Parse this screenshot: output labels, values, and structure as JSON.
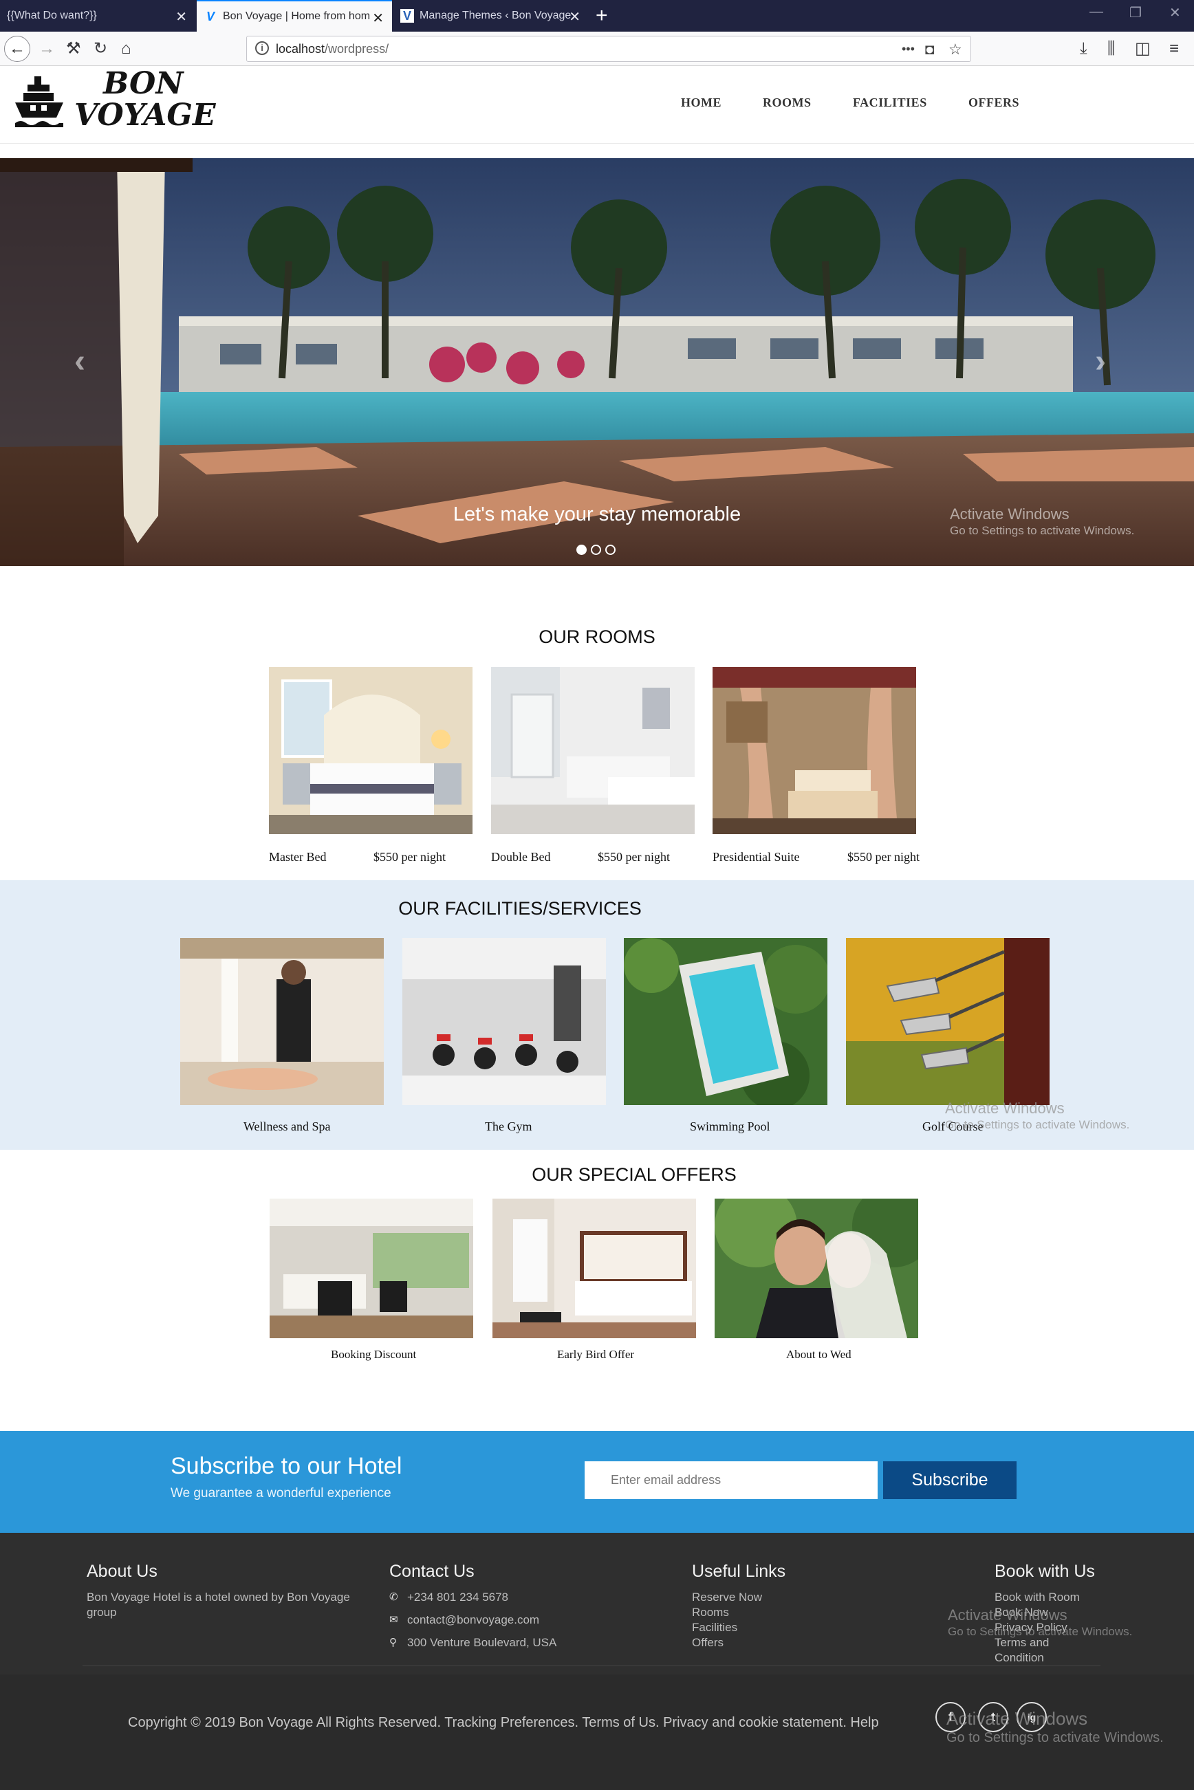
{
  "browser": {
    "tabs": [
      {
        "title": "{{What Do want?}}"
      },
      {
        "title": "Bon Voyage | Home from hom"
      },
      {
        "title": "Manage Themes ‹ Bon Voyage"
      }
    ],
    "new_tab_label": "+",
    "url_host": "localhost",
    "url_path": "/wordpress/",
    "url_menu_label": "•••"
  },
  "site": {
    "logo_line1": "BON",
    "logo_line2": "VOYAGE",
    "menu": [
      "HOME",
      "ROOMS",
      "FACILITIES",
      "OFFERS"
    ]
  },
  "hero": {
    "caption": "Let's make your stay memorable",
    "slide_count": 3,
    "active_slide": 1
  },
  "watermark": {
    "title": "Activate Windows",
    "subtitle": "Go to Settings to activate Windows."
  },
  "rooms": {
    "title": "OUR ROOMS",
    "items": [
      {
        "name": "Master Bed",
        "price": "$550 per night"
      },
      {
        "name": "Double Bed",
        "price": "$550 per night"
      },
      {
        "name": "Presidential Suite",
        "price": "$550 per night"
      }
    ]
  },
  "facilities": {
    "title": "OUR FACILITIES/SERVICES",
    "items": [
      "Wellness and Spa",
      "The Gym",
      "Swimming Pool",
      "Golf Course"
    ]
  },
  "offers": {
    "title": "OUR SPECIAL OFFERS",
    "items": [
      "Booking Discount",
      "Early Bird Offer",
      "About to Wed"
    ]
  },
  "subscribe": {
    "title": "Subscribe to our Hotel",
    "text": "We guarantee a wonderful experience",
    "placeholder": "Enter email address",
    "button": "Subscribe"
  },
  "footer": {
    "about": {
      "title": "About Us",
      "text": "Bon Voyage Hotel is a hotel owned by Bon Voyage group"
    },
    "contact": {
      "title": "Contact Us",
      "phone": "+234 801 234 5678",
      "email": "contact@bonvoyage.com",
      "address": "300 Venture Boulevard, USA"
    },
    "links": {
      "title": "Useful Links",
      "items": [
        "Reserve Now",
        "Rooms",
        "Facilities",
        "Offers"
      ]
    },
    "book": {
      "title": "Book with Us",
      "items": [
        "Book with Room",
        "Book Now",
        "Privacy Policy",
        "Terms and",
        "Condition"
      ]
    },
    "copyright": "Copyright © 2019 Bon Voyage  All Rights Reserved. Tracking Preferences. Terms of Us. Privacy and cookie statement. Help",
    "social": [
      "f",
      "t",
      "ig"
    ]
  },
  "colors": {
    "tabbar": "#202340",
    "subscribe_bg": "#2b97d9",
    "subscribe_btn": "#0b4a86",
    "facilities_bg": "#e3edf7",
    "footer_bg": "#2f2f2f"
  }
}
